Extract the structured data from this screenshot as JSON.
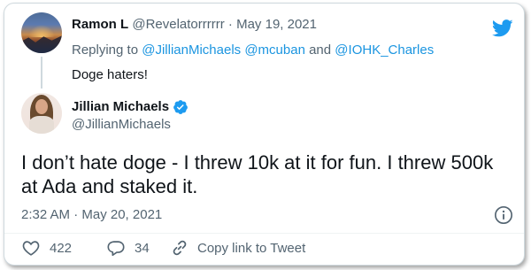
{
  "reply_tweet": {
    "author_name": "Ramon L",
    "author_handle": "@Revelatorrrrrr",
    "separator": "·",
    "date": "May 19, 2021",
    "replying_prefix": "Replying to",
    "replying_to": [
      "@JillianMichaels",
      "@mcuban",
      "@IOHK_Charles"
    ],
    "and_word": "and",
    "text": "Doge haters!"
  },
  "main_tweet": {
    "author_name": "Jillian Michaels",
    "author_handle": "@JillianMichaels",
    "verified": true,
    "text": "I don’t hate doge - I threw 10k at it for fun. I threw 500k at Ada and staked it.",
    "timestamp": "2:32 AM · May 20, 2021"
  },
  "actions": {
    "likes": "422",
    "replies": "34",
    "copy_link_label": "Copy link to Tweet"
  },
  "icons": {
    "brand": "twitter-bird-icon",
    "verified": "verified-badge-icon",
    "info": "info-icon",
    "like": "heart-icon",
    "reply": "reply-bubble-icon",
    "copy": "link-icon"
  },
  "colors": {
    "link": "#1b95e0",
    "brand": "#1d9bf0",
    "muted": "#536471",
    "text": "#0f1419"
  }
}
